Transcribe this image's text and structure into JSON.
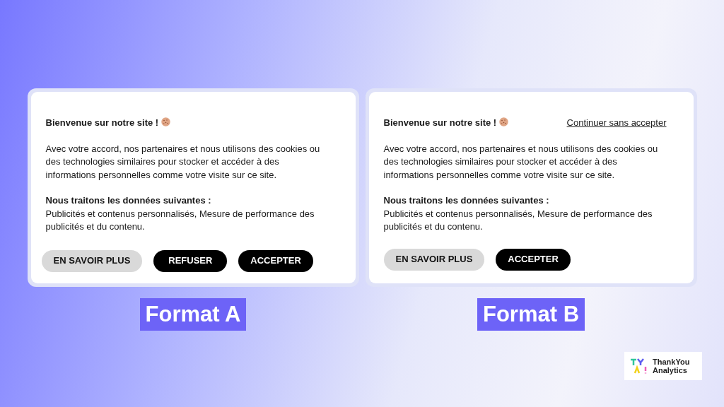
{
  "formats": [
    {
      "title": "Bienvenue sur notre site !",
      "intro": "Avec votre accord, nos partenaires et nous utilisons des cookies ou des technologies similaires pour stocker et accéder à des informations personnelles comme votre visite sur ce site.",
      "data_heading": "Nous traitons les données suivantes :",
      "data_text": "Publicités et contenus personnalisés, Mesure de performance des publicités et du contenu.",
      "buttons": [
        {
          "label": "EN SAVOIR PLUS",
          "kind": "secondary"
        },
        {
          "label": "REFUSER",
          "kind": "primary"
        },
        {
          "label": "ACCEPTER",
          "kind": "primary"
        }
      ],
      "caption": "Format A"
    },
    {
      "title": "Bienvenue sur notre site !",
      "skip_link": "Continuer sans accepter",
      "intro": "Avec votre accord, nos partenaires et nous utilisons des cookies ou des technologies similaires pour stocker et accéder à des informations personnelles comme votre visite sur ce site.",
      "data_heading": "Nous traitons les données suivantes :",
      "data_text": "Publicités et contenus personnalisés, Mesure de performance des publicités et du contenu.",
      "buttons": [
        {
          "label": "EN SAVOIR PLUS",
          "kind": "secondary"
        },
        {
          "label": "ACCEPTER",
          "kind": "primary"
        }
      ],
      "caption": "Format B"
    }
  ],
  "brand": {
    "name_line_1": "ThankYou",
    "name_line_2": "Analytics"
  }
}
